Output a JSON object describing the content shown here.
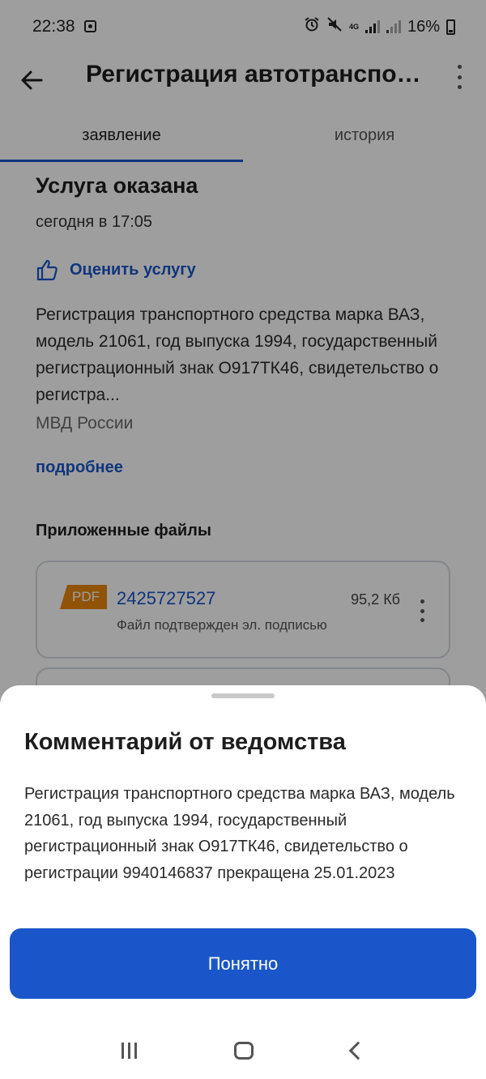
{
  "status_bar": {
    "time": "22:38",
    "network": "4G",
    "battery": "16%"
  },
  "app_bar": {
    "title": "Регистрация автотранспо…"
  },
  "tabs": [
    {
      "label": "заявление",
      "active": true
    },
    {
      "label": "история",
      "active": false
    }
  ],
  "content": {
    "status_title": "Услуга оказана",
    "status_date": "сегодня в 17:05",
    "rate_label": "Оценить услугу",
    "description": "Регистрация транспортного средства марка ВАЗ, модель 21061, год выпуска 1994, государственный регистрационный знак О917ТК46, свидетельство о регистра...",
    "agency": "МВД России",
    "more_link": "подробнее",
    "files_heading": "Приложенные файлы",
    "files": [
      {
        "badge": "PDF",
        "name": "2425727527",
        "size": "95,2 Кб",
        "note": "Файл подтвержден эл. подписью"
      }
    ]
  },
  "sheet": {
    "title": "Комментарий от ведомства",
    "text": "Регистрация транспортного средства марка ВАЗ, модель 21061, год выпуска 1994, государственный регистрационный знак О917ТК46, свидетельство о регистрации 9940146837 прекращена 25.01.2023",
    "button_label": "Понятно"
  },
  "colors": {
    "accent": "#1a56c9",
    "pdf_badge": "#e8870c",
    "scrim": "rgba(0,0,0,0.38)"
  },
  "icons": {
    "back": "arrow-left-icon",
    "more": "more-vertical-icon",
    "rate": "thumbs-up-icon"
  }
}
